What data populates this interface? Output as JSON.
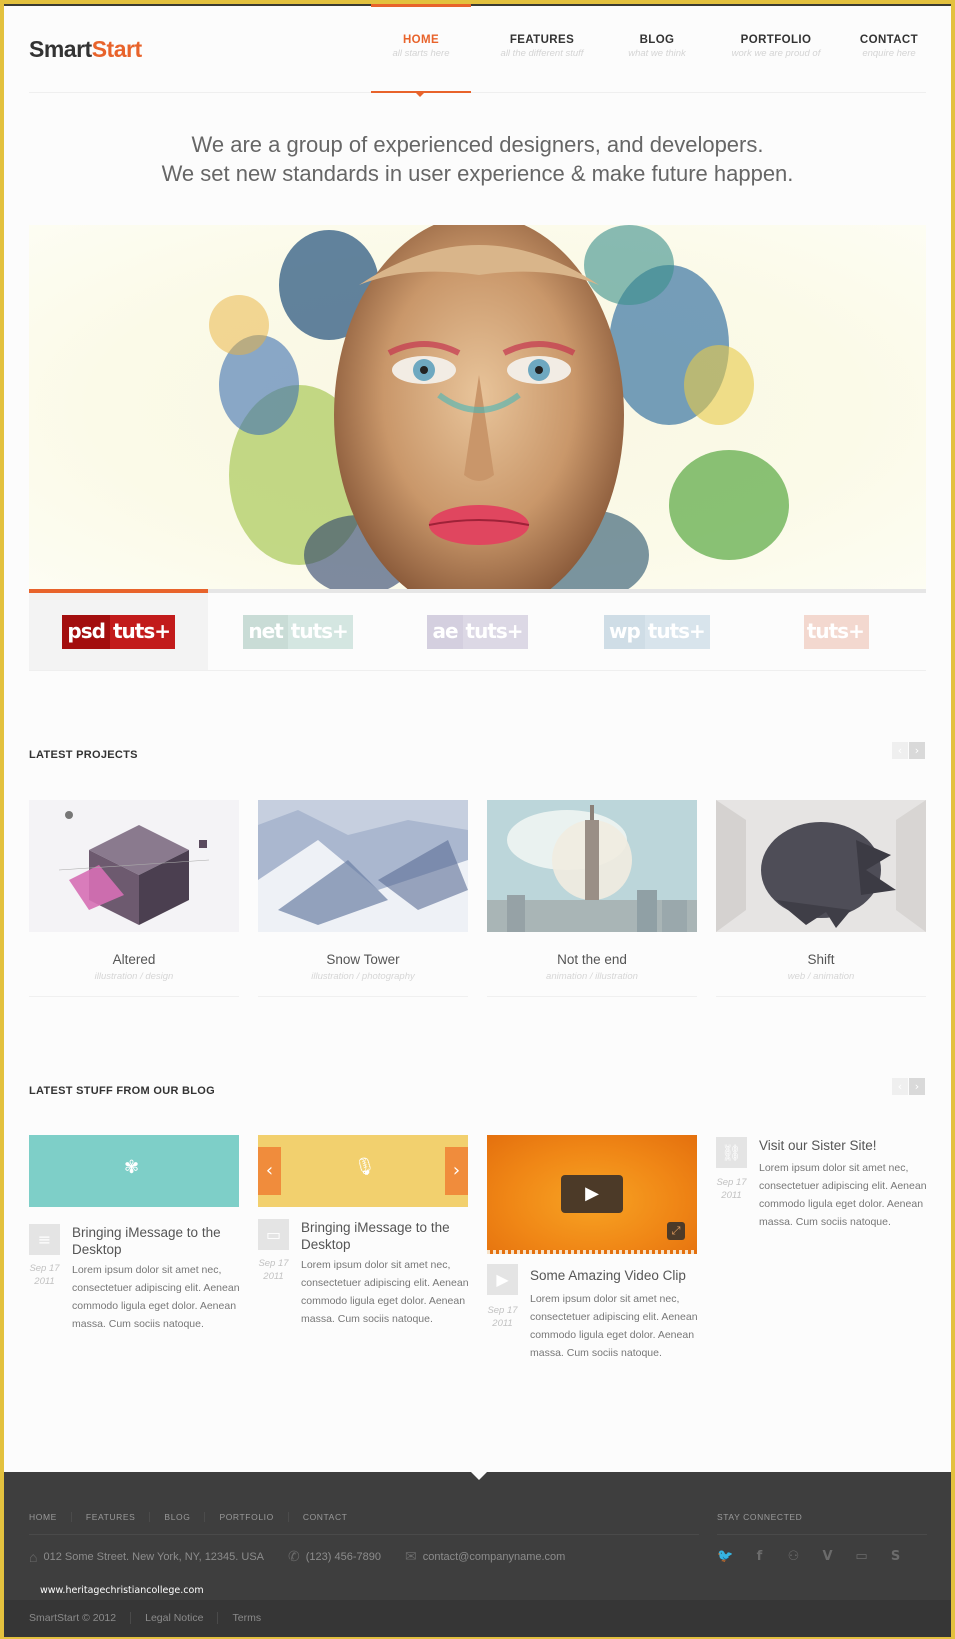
{
  "brand": {
    "name_part1": "Smart",
    "name_part2": "Start",
    "accent": "#e8632b"
  },
  "nav": [
    {
      "label": "HOME",
      "sub": "all starts here",
      "active": true
    },
    {
      "label": "FEATURES",
      "sub": "all the different stuff",
      "active": false
    },
    {
      "label": "BLOG",
      "sub": "what we think",
      "active": false
    },
    {
      "label": "PORTFOLIO",
      "sub": "work we are proud of",
      "active": false
    },
    {
      "label": "CONTACT",
      "sub": "enquire here",
      "active": false
    }
  ],
  "tagline": {
    "line1": "We are a group of experienced designers, and developers.",
    "line2": "We set new standards in user experience & make future happen."
  },
  "hero": {
    "image": "painted-face-artwork",
    "slide_progress": 0.2
  },
  "brands": [
    {
      "part1": "psd",
      "part2": "tuts+",
      "color1": "#a30e0e",
      "color2": "#c21b1b",
      "active": true
    },
    {
      "part1": "net",
      "part2": "tuts+",
      "color1": "#c9dcd6",
      "color2": "#d4e6e1",
      "active": false
    },
    {
      "part1": "ae",
      "part2": "tuts+",
      "color1": "#d4cfdf",
      "color2": "#dcd8e5",
      "active": false
    },
    {
      "part1": "wp",
      "part2": "tuts+",
      "color1": "#cfdde6",
      "color2": "#d8e4ec",
      "active": false
    },
    {
      "part1": "",
      "part2": "tuts+",
      "color1": "#f1d2c7",
      "color2": "#f3d8cf",
      "active": false
    }
  ],
  "projects": {
    "title": "LATEST PROJECTS",
    "prev_icon": "‹",
    "next_icon": "›",
    "items": [
      {
        "title": "Altered",
        "tags": "illustration / design",
        "thumb": "isometric-cube-art"
      },
      {
        "title": "Snow Tower",
        "tags": "illustration / photography",
        "thumb": "snowy-mountain"
      },
      {
        "title": "Not the end",
        "tags": "animation / illustration",
        "thumb": "city-skyline"
      },
      {
        "title": "Shift",
        "tags": "web / animation",
        "thumb": "dark-sphere"
      }
    ]
  },
  "blog": {
    "title": "LATEST STUFF FROM OUR BLOG",
    "prev_icon": "‹",
    "next_icon": "›",
    "posts": [
      {
        "title": "Bringing iMessage to the Desktop",
        "date_line1": "Sep 17",
        "date_line2": "2011",
        "type_icon": "document-icon",
        "media": "teal-app-graphic",
        "body": "Lorem ipsum dolor sit amet nec, consectetuer adipiscing elit. Aenean commodo ligula eget dolor. Aenean massa. Cum sociis natoque."
      },
      {
        "title": "Bringing iMessage to the Desktop",
        "date_line1": "Sep 17",
        "date_line2": "2011",
        "type_icon": "gallery-icon",
        "media": "yellow-mic-slider",
        "body": "Lorem ipsum dolor sit amet nec, consectetuer adipiscing elit. Aenean commodo ligula eget dolor. Aenean massa. Cum sociis natoque."
      },
      {
        "title": "Some Amazing Video Clip",
        "date_line1": "Sep 17",
        "date_line2": "2011",
        "type_icon": "play-icon",
        "media": "orange-video-player",
        "body": "Lorem ipsum dolor sit amet nec, consectetuer adipiscing elit. Aenean commodo ligula eget dolor. Aenean massa. Cum sociis natoque."
      },
      {
        "title": "Visit our Sister Site!",
        "date_line1": "Sep 17",
        "date_line2": "2011",
        "type_icon": "link-icon",
        "media": "",
        "body": "Lorem ipsum dolor sit amet nec, consectetuer adipiscing elit. Aenean commodo ligula eget dolor. Aenean massa. Cum sociis natoque."
      }
    ]
  },
  "footer": {
    "nav": [
      "HOME",
      "FEATURES",
      "BLOG",
      "PORTFOLIO",
      "CONTACT"
    ],
    "stay_connected": "STAY CONNECTED",
    "address": "012 Some Street. New York, NY, 12345. USA",
    "phone": "(123) 456-7890",
    "email": "contact@companyname.com",
    "social": [
      {
        "name": "twitter",
        "glyph": "🐦"
      },
      {
        "name": "facebook",
        "glyph": "f"
      },
      {
        "name": "flickr",
        "glyph": "⚇"
      },
      {
        "name": "vimeo",
        "glyph": "V"
      },
      {
        "name": "youtube",
        "glyph": "▭"
      },
      {
        "name": "skype",
        "glyph": "S"
      }
    ],
    "watermark": "www.heritagechristiancollege.com",
    "copyright": "SmartStart © 2012",
    "legal": "Legal Notice",
    "terms": "Terms"
  }
}
